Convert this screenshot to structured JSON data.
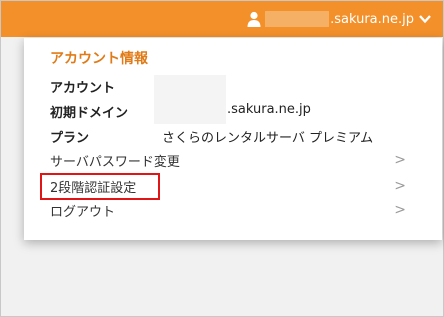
{
  "header": {
    "account_domain_suffix": ".sakura.ne.jp",
    "icons": {
      "user": "user-icon",
      "dropdown": "chevron-down-icon"
    }
  },
  "account_menu": {
    "title": "アカウント情報",
    "rows": [
      {
        "label": "アカウント",
        "value": ""
      },
      {
        "label": "初期ドメイン",
        "value": ".sakura.ne.jp"
      },
      {
        "label": "プラン",
        "value": "さくらのレンタルサーバ プレミアム"
      }
    ],
    "items": [
      {
        "label": "サーバパスワード変更",
        "arrow": ">"
      },
      {
        "label": "2段階認証設定",
        "arrow": ">"
      },
      {
        "label": "ログアウト",
        "arrow": ">"
      }
    ]
  },
  "colors": {
    "brand_orange": "#f3902a",
    "title_orange": "#e07b17",
    "highlight_red": "#e01616"
  }
}
